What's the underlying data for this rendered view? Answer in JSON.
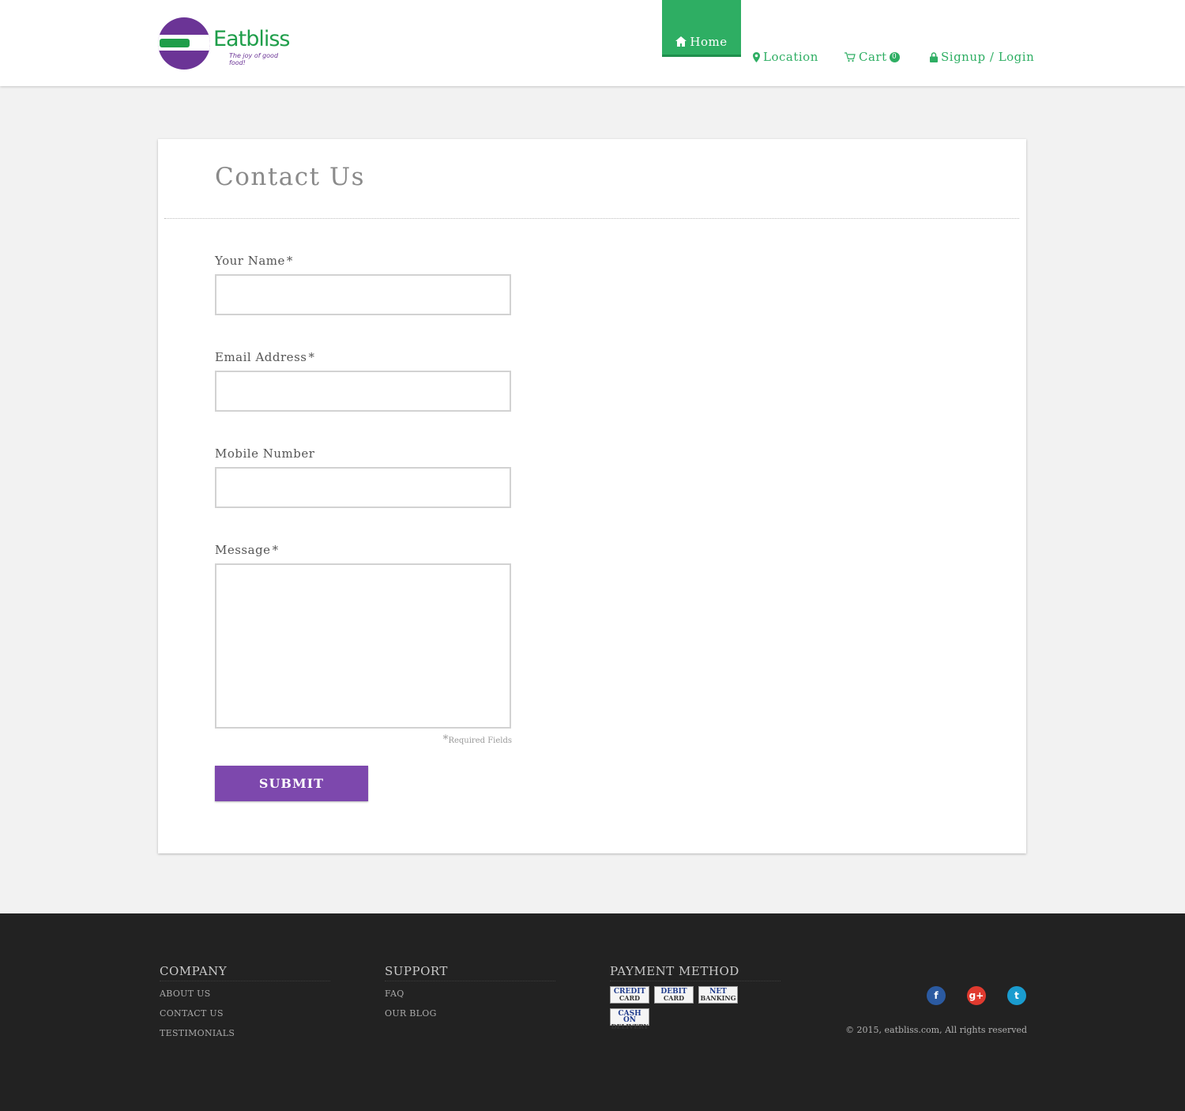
{
  "brand": {
    "name": "Eatbliss",
    "tagline": "The joy of good food!"
  },
  "nav": {
    "home": "Home",
    "location": "Location",
    "cart": "Cart",
    "cart_count": "0",
    "login": "Signup / Login"
  },
  "colors": {
    "green": "#2eae63",
    "purple": "#7d48ad",
    "footer_bg": "#222222"
  },
  "page": {
    "title": "Contact Us"
  },
  "form": {
    "name_label": "Your Name",
    "email_label": "Email Address",
    "mobile_label": "Mobile Number",
    "message_label": "Message",
    "required_mark": "*",
    "required_note": "Required Fields",
    "submit": "SUBMIT"
  },
  "footer": {
    "company": {
      "heading": "COMPANY",
      "links": [
        "ABOUT US",
        "CONTACT US",
        "TESTIMONIALS"
      ]
    },
    "support": {
      "heading": "SUPPORT",
      "links": [
        "FAQ",
        "OUR BLOG"
      ]
    },
    "payment": {
      "heading": "PAYMENT METHOD",
      "methods": [
        {
          "line1": "CREDIT",
          "line2": "CARD"
        },
        {
          "line1": "DEBIT",
          "line2": "CARD"
        },
        {
          "line1": "NET",
          "line2": "BANKING"
        },
        {
          "line1": "CASH ON",
          "line2": "DELIVERY"
        }
      ]
    },
    "social": {
      "facebook": "f",
      "google": "g+",
      "twitter": "t"
    },
    "copyright": "© 2015, eatbliss.com, All rights reserved"
  }
}
